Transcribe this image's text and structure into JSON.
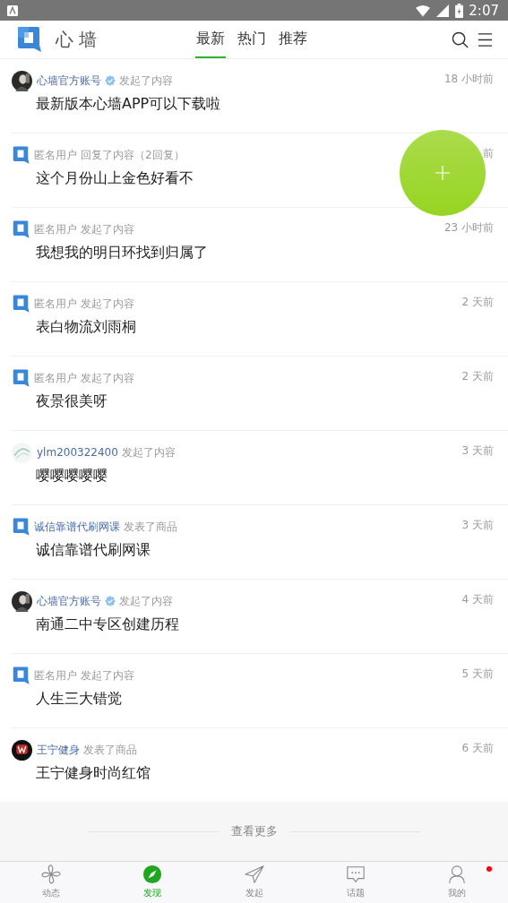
{
  "status_bar": {
    "time": "2:07"
  },
  "header": {
    "app_name": "心 墙",
    "tabs": [
      {
        "label": "最新",
        "selected": true
      },
      {
        "label": "热门",
        "selected": false
      },
      {
        "label": "推荐",
        "selected": false
      }
    ]
  },
  "feed": [
    {
      "author": "心墙官方账号",
      "linked": true,
      "verified": true,
      "action": "发起了内容",
      "time": "18 小时前",
      "title": "最新版本心墙APP可以下载啦"
    },
    {
      "avatar": {
        "kind": "logo"
      },
      "author": "匿名用户",
      "linked": false,
      "verified": false,
      "action": "回复了内容（2回复）",
      "time": "前",
      "title": "这个月份山上金色好看不"
    },
    {
      "avatar": {
        "kind": "logo"
      },
      "author": "匿名用户",
      "linked": false,
      "verified": false,
      "action": "发起了内容",
      "time": "23 小时前",
      "title": "我想我的明日环找到归属了"
    },
    {
      "avatar": {
        "kind": "logo"
      },
      "author": "匿名用户",
      "linked": false,
      "verified": false,
      "action": "发起了内容",
      "time": "2 天前",
      "title": "表白物流刘雨桐"
    },
    {
      "avatar": {
        "kind": "logo"
      },
      "author": "匿名用户",
      "linked": false,
      "verified": false,
      "action": "发起了内容",
      "time": "2 天前",
      "title": "夜景很美呀"
    },
    {
      "avatar": {
        "kind": "sketch"
      },
      "author": "ylm200322400",
      "linked": true,
      "verified": false,
      "action": "发起了内容",
      "time": "3 天前",
      "title": "嘤嘤嘤嘤嘤"
    },
    {
      "avatar": {
        "kind": "logo"
      },
      "author": "诚信靠谱代刷网课",
      "linked": true,
      "verified": false,
      "action": "发表了商品",
      "time": "3 天前",
      "title": "诚信靠谱代刷网课"
    },
    {
      "author": "心墙官方账号",
      "linked": true,
      "verified": true,
      "action": "发起了内容",
      "time": "4 天前",
      "title": "南通二中专区创建历程"
    },
    {
      "avatar": {
        "kind": "logo"
      },
      "author": "匿名用户",
      "linked": false,
      "verified": false,
      "action": "发起了内容",
      "time": "5 天前",
      "title": "人生三大错觉"
    },
    {
      "avatar": {
        "kind": "dark"
      },
      "author": "王宁健身",
      "linked": true,
      "verified": false,
      "action": "发表了商品",
      "time": "6 天前",
      "title": "王宁健身时尚红馆"
    }
  ],
  "more_label": "查看更多",
  "bottom_nav": [
    {
      "kind": "pinwheel",
      "label": "动态",
      "selected": false,
      "badge": false
    },
    {
      "kind": "compass",
      "label": "发现",
      "selected": true,
      "badge": false
    },
    {
      "kind": "send",
      "label": "发起",
      "selected": false,
      "badge": false
    },
    {
      "kind": "chat",
      "label": "话题",
      "selected": false,
      "badge": false
    },
    {
      "kind": "person",
      "label": "我的",
      "selected": false,
      "badge": true
    }
  ]
}
